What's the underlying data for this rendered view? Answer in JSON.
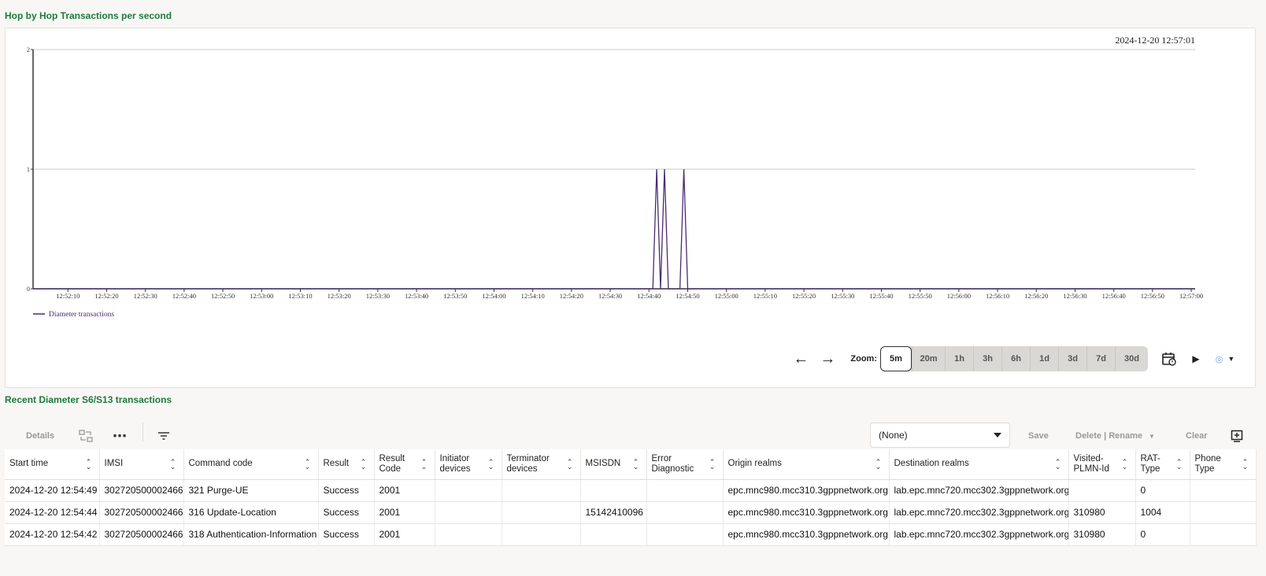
{
  "chart_section": {
    "title": "Hop by Hop Transactions per second"
  },
  "chart_data": {
    "type": "line",
    "timestamp_label": "2024-12-20 12:57:01",
    "x_start": "12:52:01",
    "x_end": "12:57:01",
    "x_ticks": [
      "12:52:10",
      "12:52:20",
      "12:52:30",
      "12:52:40",
      "12:52:50",
      "12:53:00",
      "12:53:10",
      "12:53:20",
      "12:53:30",
      "12:53:40",
      "12:53:50",
      "12:54:00",
      "12:54:10",
      "12:54:20",
      "12:54:30",
      "12:54:40",
      "12:54:50",
      "12:55:00",
      "12:55:10",
      "12:55:20",
      "12:55:30",
      "12:55:40",
      "12:55:50",
      "12:56:00",
      "12:56:10",
      "12:56:20",
      "12:56:30",
      "12:56:40",
      "12:56:50",
      "12:57:00"
    ],
    "y_ticks": [
      0,
      1,
      2
    ],
    "ylim": [
      0,
      2
    ],
    "grid": true,
    "legend_position": "bottom-left",
    "series": [
      {
        "name": "Diameter transactions",
        "color": "#4a2c6e",
        "points": [
          {
            "t": "12:52:01",
            "v": 0
          },
          {
            "t": "12:54:41",
            "v": 0
          },
          {
            "t": "12:54:42",
            "v": 1
          },
          {
            "t": "12:54:43",
            "v": 0
          },
          {
            "t": "12:54:44",
            "v": 1
          },
          {
            "t": "12:54:45",
            "v": 0
          },
          {
            "t": "12:54:48",
            "v": 0
          },
          {
            "t": "12:54:49",
            "v": 1
          },
          {
            "t": "12:54:50",
            "v": 0
          },
          {
            "t": "12:57:01",
            "v": 0
          }
        ]
      }
    ]
  },
  "controls": {
    "zoom_label": "Zoom:",
    "zoom_options": [
      "5m",
      "20m",
      "1h",
      "3h",
      "6h",
      "1d",
      "3d",
      "7d",
      "30d"
    ],
    "active_zoom": "5m"
  },
  "table_section": {
    "title": "Recent Diameter S6/S13 transactions"
  },
  "toolbar": {
    "details_label": "Details",
    "view_select": "(None)",
    "save_label": "Save",
    "delete_rename_label": "Delete | Rename",
    "clear_label": "Clear"
  },
  "table": {
    "columns": [
      "Start time",
      "IMSI",
      "Command code",
      "Result",
      "Result Code",
      "Initiator devices",
      "Terminator devices",
      "MSISDN",
      "Error Diagnostic",
      "Origin realms",
      "Destination realms",
      "Visited-PLMN-Id",
      "RAT-Type",
      "Phone Type"
    ],
    "rows": [
      [
        "2024-12-20 12:54:49",
        "302720500002466",
        "321 Purge-UE",
        "Success",
        "2001",
        "",
        "",
        "",
        "",
        "epc.mnc980.mcc310.3gppnetwork.org",
        "lab.epc.mnc720.mcc302.3gppnetwork.org",
        "",
        "0",
        ""
      ],
      [
        "2024-12-20 12:54:44",
        "302720500002466",
        "316 Update-Location",
        "Success",
        "2001",
        "",
        "",
        "15142410096",
        "",
        "epc.mnc980.mcc310.3gppnetwork.org",
        "lab.epc.mnc720.mcc302.3gppnetwork.org",
        "310980",
        "1004",
        ""
      ],
      [
        "2024-12-20 12:54:42",
        "302720500002466",
        "318 Authentication-Information",
        "Success",
        "2001",
        "",
        "",
        "",
        "",
        "epc.mnc980.mcc310.3gppnetwork.org",
        "lab.epc.mnc720.mcc302.3gppnetwork.org",
        "310980",
        "0",
        ""
      ]
    ]
  }
}
